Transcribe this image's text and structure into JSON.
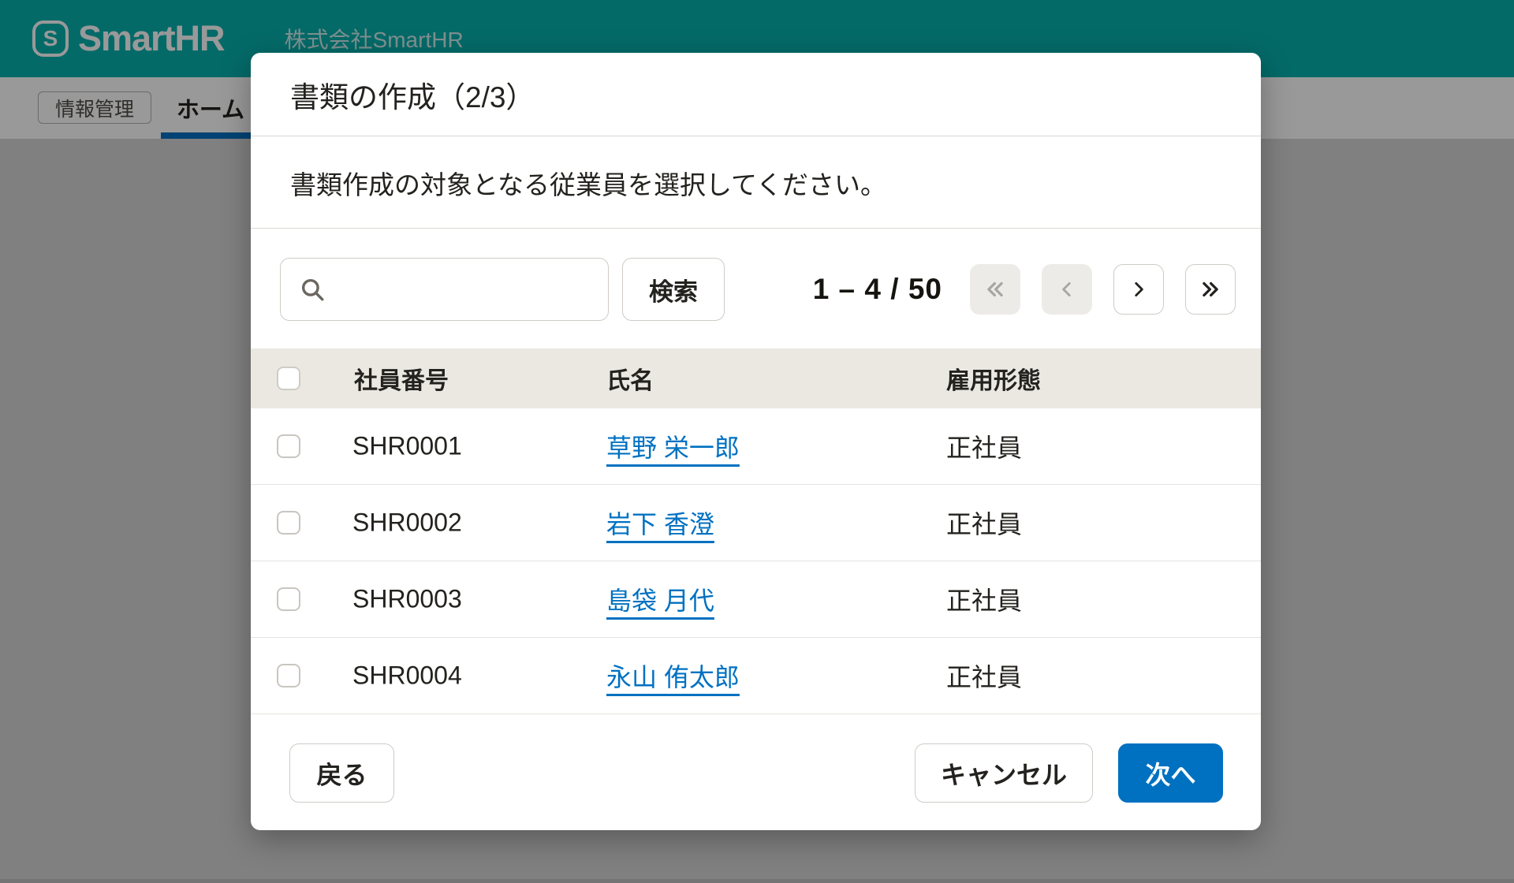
{
  "header": {
    "logo_mark": "S",
    "logo_text": "SmartHR",
    "company_name": "株式会社SmartHR"
  },
  "nav": {
    "scope_label": "情報管理",
    "home_tab_label": "ホーム"
  },
  "dialog": {
    "title": "書類の作成（2/3）",
    "description": "書類作成の対象となる従業員を選択してください。",
    "search": {
      "value": "",
      "button_label": "検索"
    },
    "pagination": {
      "range": "1 – 4 / 50",
      "buttons": [
        {
          "name": "first-page",
          "disabled": true
        },
        {
          "name": "prev-page",
          "disabled": true
        },
        {
          "name": "next-page",
          "disabled": false
        },
        {
          "name": "last-page",
          "disabled": false
        }
      ]
    },
    "table": {
      "select_all_checked": false,
      "columns": [
        "社員番号",
        "氏名",
        "雇用形態"
      ],
      "rows": [
        {
          "checked": false,
          "id": "SHR0001",
          "name": "草野 栄一郎",
          "type": "正社員"
        },
        {
          "checked": false,
          "id": "SHR0002",
          "name": "岩下 香澄",
          "type": "正社員"
        },
        {
          "checked": false,
          "id": "SHR0003",
          "name": "島袋 月代",
          "type": "正社員"
        },
        {
          "checked": false,
          "id": "SHR0004",
          "name": "永山 侑太郎",
          "type": "正社員"
        }
      ]
    },
    "footer": {
      "back": "戻る",
      "cancel": "キャンセル",
      "next": "次へ"
    }
  },
  "colors": {
    "brand_teal": "#08B1AD",
    "primary_blue": "#0071C1",
    "link_blue": "#0071C1",
    "table_header_bg": "#EBE8E2",
    "overlay": "rgba(0,0,0,0.4)"
  }
}
